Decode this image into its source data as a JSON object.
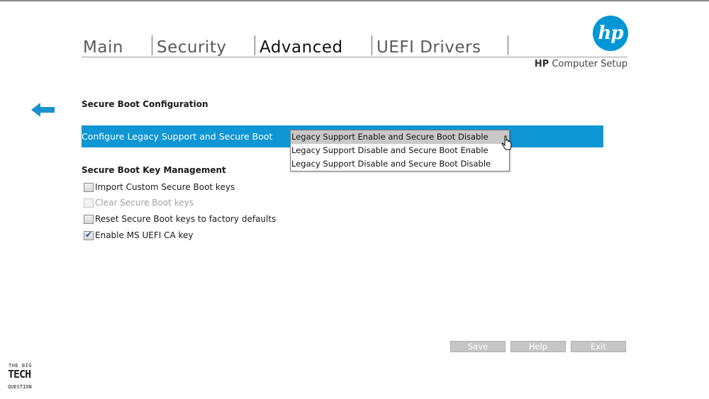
{
  "tabs": [
    {
      "label": "Main",
      "active": false
    },
    {
      "label": "Security",
      "active": false
    },
    {
      "label": "Advanced",
      "active": true
    },
    {
      "label": "UEFI Drivers",
      "active": false
    }
  ],
  "brand": {
    "logo_text": "hp",
    "title_bold": "HP",
    "title_rest": " Computer Setup",
    "accent": "#0096d6"
  },
  "page": {
    "section_title": "Secure Boot Configuration",
    "back_icon": "back-arrow-icon"
  },
  "config": {
    "label": "Configure Legacy Support and Secure Boot",
    "highlight_color": "#0f96d4",
    "options": [
      "Legacy Support Enable and Secure Boot Disable",
      "Legacy Support Disable and Secure Boot Enable",
      "Legacy Support Disable and Secure Boot Disable"
    ],
    "hovered_index": 0
  },
  "key_management": {
    "title": "Secure Boot Key Management",
    "items": [
      {
        "label": "Import Custom Secure Boot keys",
        "checked": false,
        "disabled": false
      },
      {
        "label": "Clear Secure Boot keys",
        "checked": false,
        "disabled": true
      },
      {
        "label": "Reset Secure Boot keys to factory defaults",
        "checked": false,
        "disabled": false
      },
      {
        "label": "Enable MS UEFI CA key",
        "checked": true,
        "disabled": false
      }
    ]
  },
  "footer": {
    "save": "Save",
    "help": "Help",
    "exit": "Exit"
  },
  "watermark": {
    "line1": "THE BIG",
    "line2": "TECH",
    "line3": "QUESTION"
  }
}
